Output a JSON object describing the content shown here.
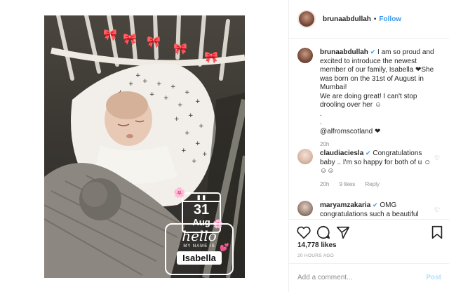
{
  "post": {
    "username": "brunaabdullah",
    "separator": "•",
    "follow_label": "Follow",
    "caption_user": "brunaabdullah",
    "caption_text": "I am so proud and excited to introduce the newest member of our family, Isabella ❤She was born on the 31st of August in Mumbai!",
    "caption_text2": "We are doing great! I can't stop drooling over her ☺",
    "caption_dots": ".",
    "caption_dots2": ".",
    "caption_mention": "@alfromscotland ❤",
    "caption_time": "20h",
    "likes": "14,778 likes",
    "posted": "20 HOURS AGO",
    "add_comment_placeholder": "Add a comment...",
    "post_label": "Post"
  },
  "photo": {
    "date_day": "31",
    "date_month": "Aug",
    "hello": "hello",
    "my_name_is": "MY NAME IS",
    "baby_name": "Isabella"
  },
  "comments": [
    {
      "user": "claudiaciesla",
      "text": "Congratulations baby .. I'm so happy for both of u ☺☺☺",
      "time": "20h",
      "likes": "9 likes",
      "reply": "Reply"
    },
    {
      "user": "maryamzakaria",
      "text": "OMG congratulations such a beautiful",
      "time": "",
      "likes": "",
      "reply": ""
    }
  ],
  "colors": {
    "accent": "#3897f0",
    "muted": "#8e8e8e",
    "post_disabled": "#b2dffc"
  }
}
